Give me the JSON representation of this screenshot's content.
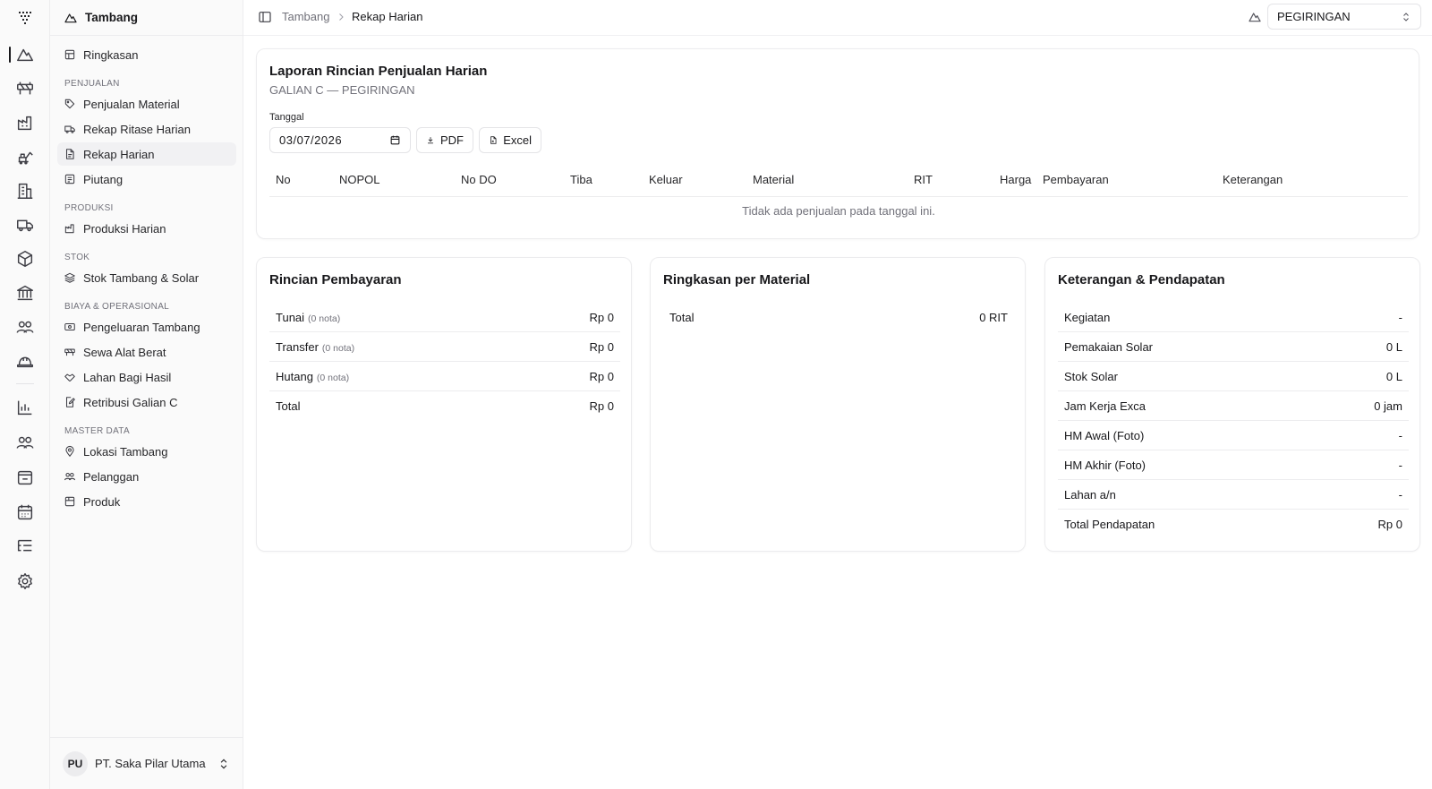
{
  "sidebar": {
    "header_title": "Tambang",
    "items": [
      {
        "label": "Ringkasan"
      },
      {
        "label": "Penjualan Material"
      },
      {
        "label": "Rekap Ritase Harian"
      },
      {
        "label": "Rekap Harian"
      },
      {
        "label": "Piutang"
      },
      {
        "label": "Produksi Harian"
      },
      {
        "label": "Stok Tambang & Solar"
      },
      {
        "label": "Pengeluaran Tambang"
      },
      {
        "label": "Sewa Alat Berat"
      },
      {
        "label": "Lahan Bagi Hasil"
      },
      {
        "label": "Retribusi Galian C"
      },
      {
        "label": "Lokasi Tambang"
      },
      {
        "label": "Pelanggan"
      },
      {
        "label": "Produk"
      }
    ],
    "groups": [
      "PENJUALAN",
      "PRODUKSI",
      "STOK",
      "BIAYA & OPERASIONAL",
      "MASTER DATA"
    ],
    "footer": {
      "initials": "PU",
      "name": "PT. Saka Pilar Utama"
    }
  },
  "header": {
    "breadcrumb": [
      "Tambang",
      "Rekap Harian"
    ],
    "location": "PEGIRINGAN"
  },
  "report": {
    "title": "Laporan Rincian Penjualan Harian",
    "subtitle": "GALIAN C — PEGIRINGAN",
    "date_label": "Tanggal",
    "date_value": "03/07/2026",
    "pdf_label": "PDF",
    "excel_label": "Excel",
    "columns": [
      "No",
      "NOPOL",
      "No DO",
      "Tiba",
      "Keluar",
      "Material",
      "RIT",
      "Harga",
      "Pembayaran",
      "Keterangan"
    ],
    "empty_message": "Tidak ada penjualan pada tanggal ini."
  },
  "payment": {
    "title": "Rincian Pembayaran",
    "rows": [
      {
        "label": "Tunai",
        "note": "(0 nota)",
        "value": "Rp 0"
      },
      {
        "label": "Transfer",
        "note": "(0 nota)",
        "value": "Rp 0"
      },
      {
        "label": "Hutang",
        "note": "(0 nota)",
        "value": "Rp 0"
      },
      {
        "label": "Total",
        "note": "",
        "value": "Rp 0"
      }
    ]
  },
  "material_summary": {
    "title": "Ringkasan per Material",
    "rows": [
      {
        "label": "Total",
        "value": "0 RIT"
      }
    ]
  },
  "income": {
    "title": "Keterangan & Pendapatan",
    "rows": [
      {
        "label": "Kegiatan",
        "value": "-"
      },
      {
        "label": "Pemakaian Solar",
        "value": "0 L"
      },
      {
        "label": "Stok Solar",
        "value": "0 L"
      },
      {
        "label": "Jam Kerja Exca",
        "value": "0 jam"
      },
      {
        "label": "HM Awal (Foto)",
        "value": "-"
      },
      {
        "label": "HM Akhir (Foto)",
        "value": "-"
      },
      {
        "label": "Lahan a/n",
        "value": "-"
      },
      {
        "label": "Total Pendapatan",
        "value": "Rp 0"
      }
    ]
  }
}
